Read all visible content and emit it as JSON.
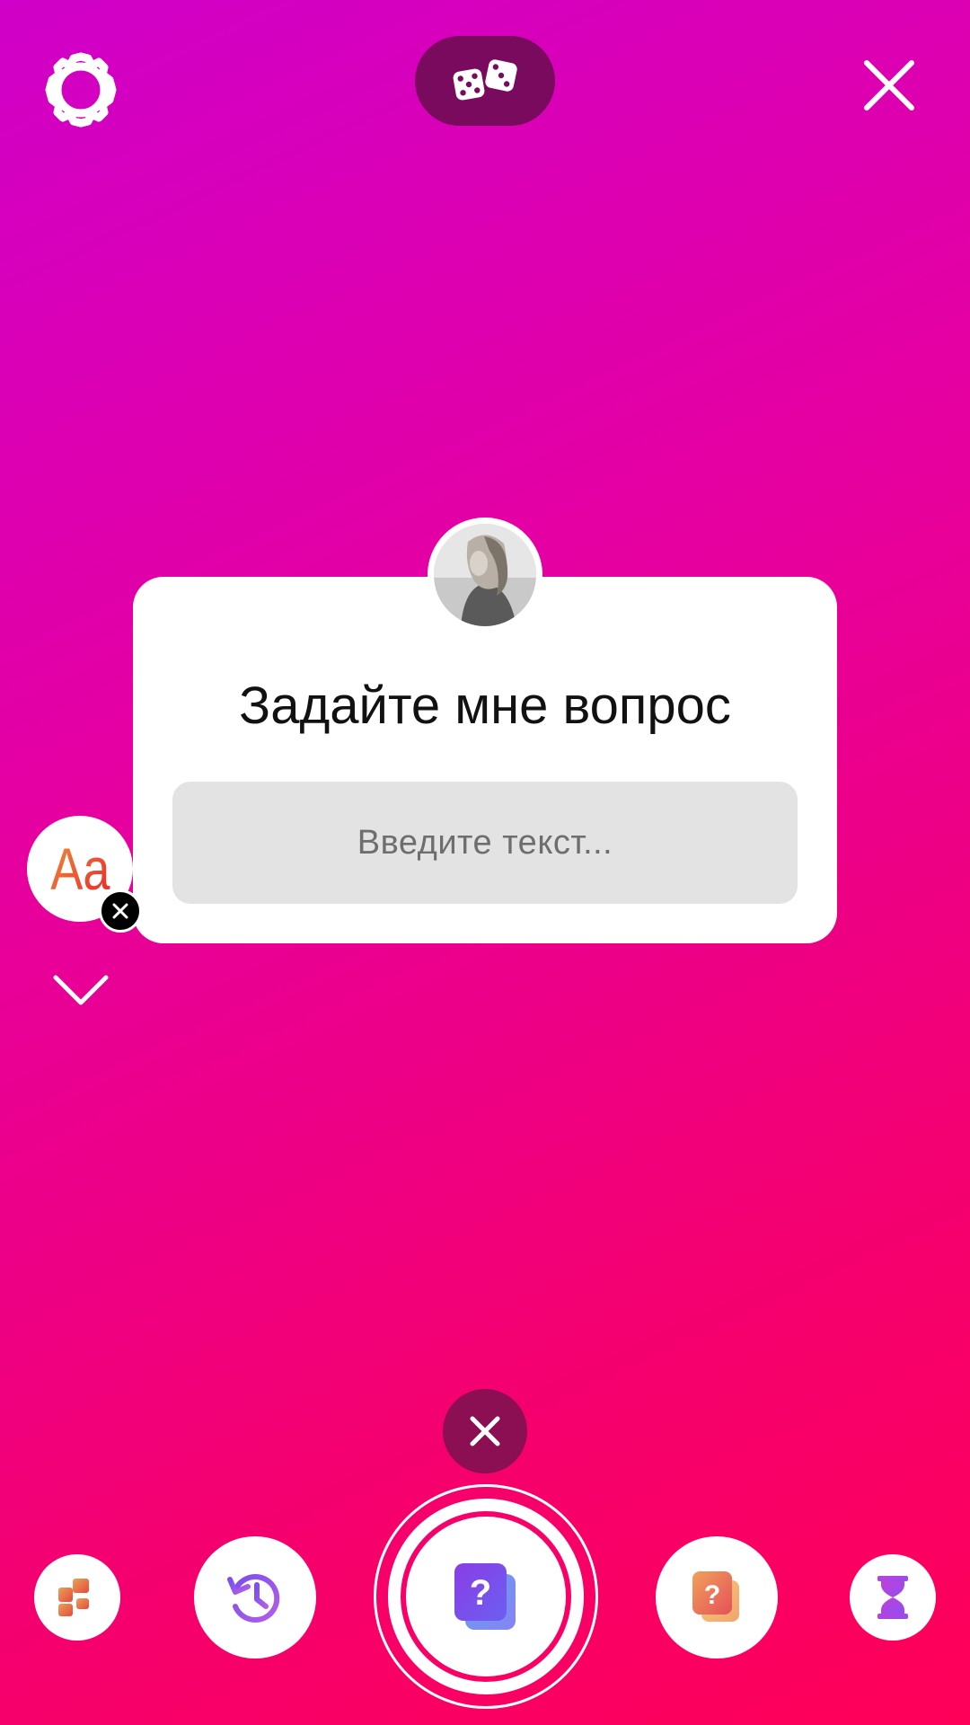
{
  "sticker": {
    "question": "Задайте мне вопрос",
    "placeholder": "Введите текст..."
  },
  "font_button": {
    "label": "Aa"
  },
  "icons": {
    "top_left": "settings-gear-icon",
    "top_center": "dice-icon",
    "top_right": "close-icon",
    "trash": "delete-icon",
    "tray": [
      "layout-icon",
      "history-icon",
      "question-sticker-icon",
      "question-sticker-icon",
      "hourglass-icon"
    ]
  },
  "colors": {
    "background_start": "#d000c8",
    "background_end": "#ff0058",
    "pill": "#7a0a5e",
    "trash": "#8b0f52",
    "answer_box": "#e3e3e3"
  }
}
